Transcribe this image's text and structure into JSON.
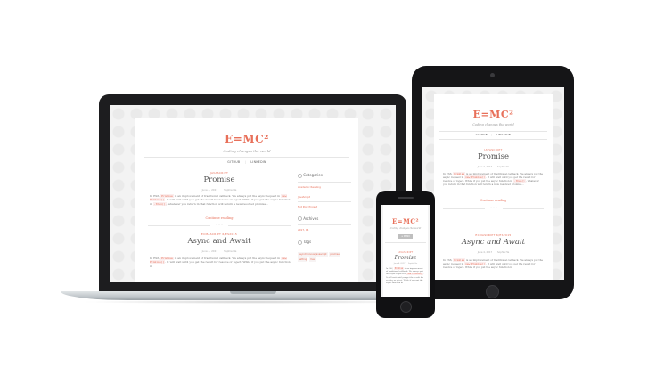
{
  "site": {
    "title": "E=MC²",
    "tagline": "Coding changes the world",
    "nav": [
      "GITHUB",
      "LINKEDIN"
    ],
    "nav_separator": "|"
  },
  "posts": [
    {
      "category": "JAVASCRIPT",
      "title": "Promise",
      "date": "June 4, 2017",
      "author": "Sophie He",
      "excerpt_start": "In ES6,",
      "excerpt_code1": "Promise",
      "excerpt_mid": "is an improvement of traditional callback. We always put the async request in",
      "excerpt_code2": "new Promise()",
      "excerpt_rest": "It will wait until you get the result for resolve or reject. While if you put the async function in",
      "excerpt_code3": ".then()",
      "excerpt_end": ", whatever you return in that function will return a new resolved promise...",
      "continue": "Continue reading"
    },
    {
      "category": "ECMASCRIPT 6/ES2015",
      "title": "Async and Await",
      "date": "June 4, 2017",
      "author": "Sophie He",
      "excerpt_start": "In ES6,",
      "excerpt_code1": "Promise",
      "excerpt_mid": "is an improvement of traditional callback. We always put the async request in",
      "excerpt_code2": "new Promise()",
      "excerpt_rest": "It will wait until you get the result for resolve or reject. While if you put the async function in"
    }
  ],
  "sidebar": {
    "categories_title": "Categories",
    "categories": [
      "Academic Reading",
      "JavaScript",
      "Not Post Project"
    ],
    "archives_title": "Archives",
    "archives": [
      "2017, 04"
    ],
    "tags_title": "Tags",
    "tags": [
      "asynchronous/javascript",
      "promise",
      "Setting",
      "Vue"
    ]
  },
  "phone": {
    "menu_label": "≡ MENU"
  },
  "colors": {
    "accent": "#e8705a",
    "device_dark": "#1d1d1f"
  }
}
